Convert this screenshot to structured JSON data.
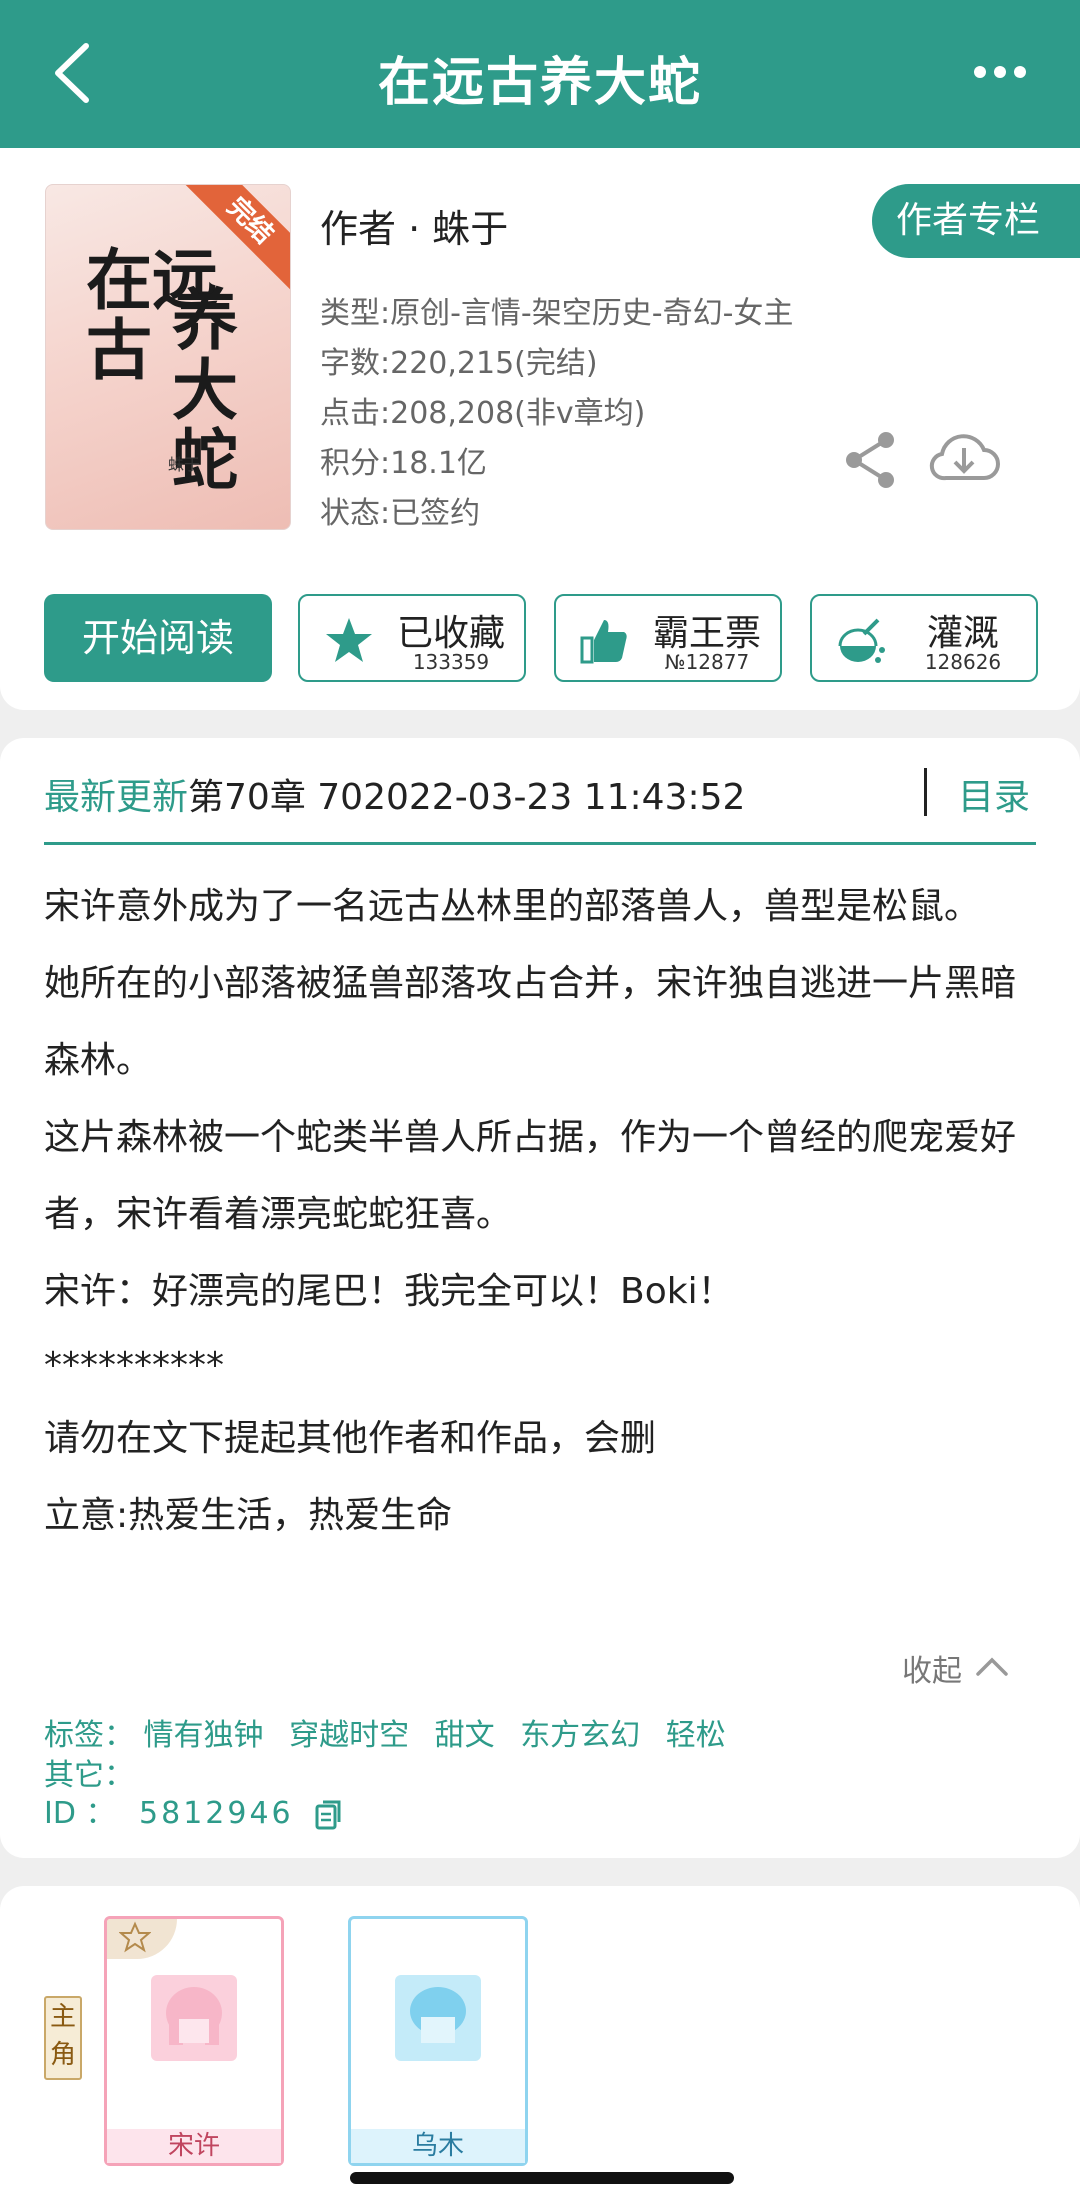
{
  "header": {
    "title": "在远古养大蛇"
  },
  "book": {
    "cover": {
      "title_line1": "在远",
      "title_line2": "古",
      "title_line3": "养",
      "title_line4": "大蛇",
      "author": "蛛于",
      "ribbon": "完结"
    },
    "author_label": "作者 · 蛛于",
    "author_column_button": "作者专栏",
    "meta": [
      "类型:原创-言情-架空历史-奇幻-女主",
      "字数:220,215(完结)",
      "点击:208,208(非v章均)",
      "积分:18.1亿",
      "状态:已签约"
    ]
  },
  "actions": {
    "start_reading": "开始阅读",
    "items": [
      {
        "label": "已收藏",
        "count": "133359",
        "icon": "star-icon"
      },
      {
        "label": "霸王票",
        "count": "№12877",
        "icon": "thumbs-up-icon"
      },
      {
        "label": "灌溉",
        "count": "128626",
        "icon": "watering-icon"
      }
    ]
  },
  "update": {
    "label": "最新更新",
    "text": "第70章 702022-03-23 11:43:52",
    "toc": "目录"
  },
  "intro": [
    "宋许意外成为了一名远古丛林里的部落兽人，兽型是松鼠。",
    "她所在的小部落被猛兽部落攻占合并，宋许独自逃进一片黑暗森林。",
    "这片森林被一个蛇类半兽人所占据，作为一个曾经的爬宠爱好者，宋许看着漂亮蛇蛇狂喜。",
    "宋许：好漂亮的尾巴！我完全可以！Boki！",
    "**********",
    "请勿在文下提起其他作者和作品，会删",
    "立意:热爱生活，热爱生命"
  ],
  "collapse": "收起",
  "tags": {
    "label": "标签：",
    "items": [
      "情有独钟",
      "穿越时空",
      "甜文",
      "东方玄幻",
      "轻松"
    ],
    "other_label": "其它：",
    "id_label": "ID  ：",
    "id_value": "5812946"
  },
  "characters": {
    "role_label": "主角",
    "items": [
      {
        "name": "宋许",
        "theme": "pink"
      },
      {
        "name": "乌木",
        "theme": "blue"
      }
    ]
  },
  "colors": {
    "primary": "#2e9b8a",
    "ribbon": "#e2643a"
  }
}
